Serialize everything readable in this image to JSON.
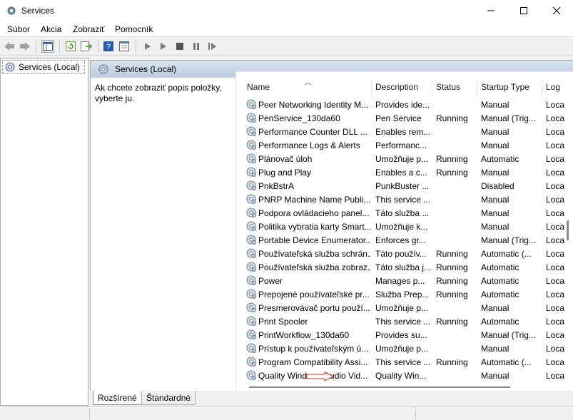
{
  "window": {
    "title": "Services"
  },
  "menu": [
    "Súbor",
    "Akcia",
    "Zobraziť",
    "Pomocník"
  ],
  "toolbar": [
    "back-icon",
    "forward-icon",
    "show-hide-tree-icon",
    "refresh-icon",
    "export-list-icon",
    "help-icon",
    "properties-icon",
    "start-service-icon",
    "start-service-alt-icon",
    "stop-service-icon",
    "pause-service-icon",
    "resume-service-icon"
  ],
  "tree": {
    "item": "Services (Local)"
  },
  "content": {
    "header": "Services (Local)",
    "description": "Ak chcete zobraziť popis položky, vyberte ju."
  },
  "columns": {
    "name": "Name",
    "description": "Description",
    "status": "Status",
    "startup": "Startup Type",
    "log": "Log"
  },
  "rows": [
    {
      "name": "Peer Networking Identity M...",
      "description": "Provides ide...",
      "status": "",
      "startup": "Manual",
      "log": "Loca"
    },
    {
      "name": "PenService_130da60",
      "description": "Pen Service",
      "status": "Running",
      "startup": "Manual (Trig...",
      "log": "Loca"
    },
    {
      "name": "Performance Counter DLL ...",
      "description": "Enables rem...",
      "status": "",
      "startup": "Manual",
      "log": "Loca"
    },
    {
      "name": "Performance Logs & Alerts",
      "description": "Performanc...",
      "status": "",
      "startup": "Manual",
      "log": "Loca"
    },
    {
      "name": "Plánovač úloh",
      "description": "Umožňuje p...",
      "status": "Running",
      "startup": "Automatic",
      "log": "Loca"
    },
    {
      "name": "Plug and Play",
      "description": "Enables a c...",
      "status": "Running",
      "startup": "Manual",
      "log": "Loca"
    },
    {
      "name": "PnkBstrA",
      "description": "PunkBuster ...",
      "status": "",
      "startup": "Disabled",
      "log": "Loca"
    },
    {
      "name": "PNRP Machine Name Publi...",
      "description": "This service ...",
      "status": "",
      "startup": "Manual",
      "log": "Loca"
    },
    {
      "name": "Podpora ovládacieho panel...",
      "description": "Táto služba ...",
      "status": "",
      "startup": "Manual",
      "log": "Loca"
    },
    {
      "name": "Politika vybratia karty Smart...",
      "description": "Umožňuje k...",
      "status": "",
      "startup": "Manual",
      "log": "Loca"
    },
    {
      "name": "Portable Device Enumerator...",
      "description": "Enforces gr...",
      "status": "",
      "startup": "Manual (Trig...",
      "log": "Loca"
    },
    {
      "name": "Používateľská služba schrán...",
      "description": "Táto použív...",
      "status": "Running",
      "startup": "Automatic (...",
      "log": "Loca"
    },
    {
      "name": "Používateľská služba zobraz...",
      "description": "Táto služba j...",
      "status": "Running",
      "startup": "Automatic",
      "log": "Loca"
    },
    {
      "name": "Power",
      "description": "Manages p...",
      "status": "Running",
      "startup": "Automatic",
      "log": "Loca"
    },
    {
      "name": "Prepojené používateľské pr...",
      "description": "Služba Prep...",
      "status": "Running",
      "startup": "Automatic",
      "log": "Loca"
    },
    {
      "name": "Presmerovávač portu použí...",
      "description": "Umožňuje p...",
      "status": "",
      "startup": "Manual",
      "log": "Loca"
    },
    {
      "name": "Print Spooler",
      "description": "This service ...",
      "status": "Running",
      "startup": "Automatic",
      "log": "Loca"
    },
    {
      "name": "PrintWorkflow_130da60",
      "description": "Provides su...",
      "status": "",
      "startup": "Manual (Trig...",
      "log": "Loca"
    },
    {
      "name": "Prístup k používateľským ú...",
      "description": "Umožňuje p...",
      "status": "",
      "startup": "Manual",
      "log": "Loca"
    },
    {
      "name": "Program Compatibility Assi...",
      "description": "This service ...",
      "status": "Running",
      "startup": "Automatic (...",
      "log": "Loca"
    },
    {
      "name": "Quality Windows Audio Vid...",
      "description": "Quality Win...",
      "status": "",
      "startup": "Manual",
      "log": "Loca"
    }
  ],
  "tabs": [
    "Rozšírené",
    "Štandardné"
  ],
  "colors": {
    "arrow": "#c0392b",
    "header_gradient": "#c7d5e8"
  }
}
